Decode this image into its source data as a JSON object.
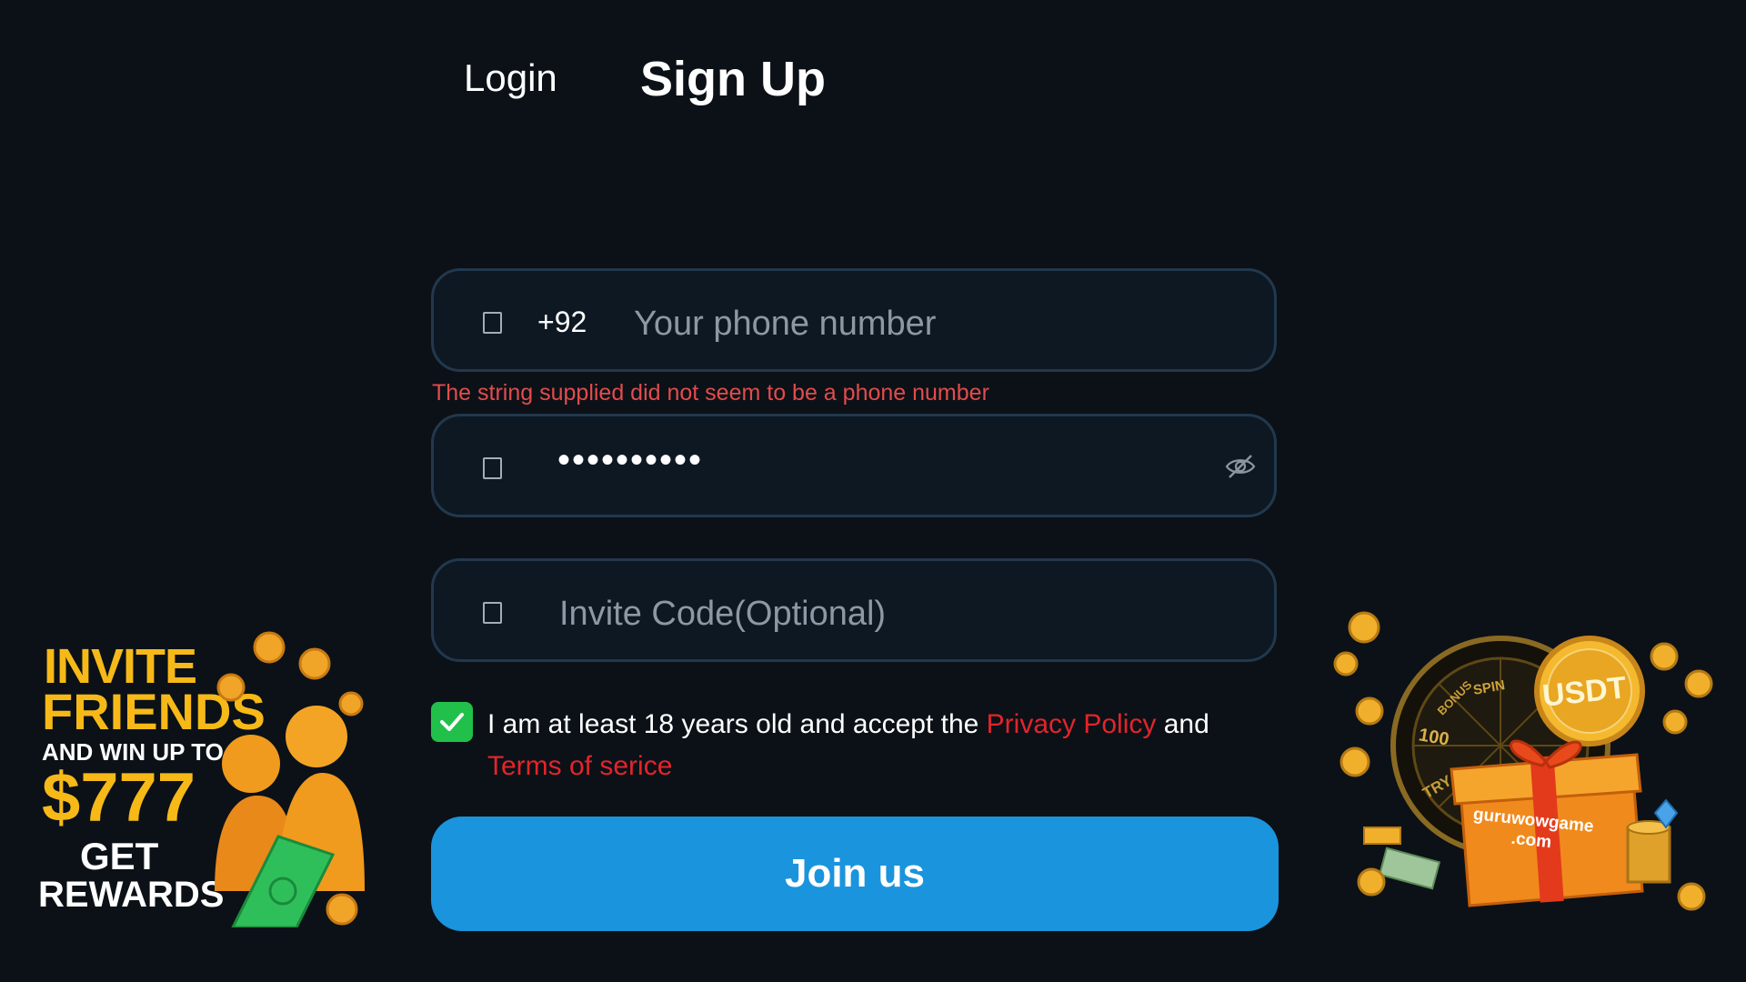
{
  "tabs": {
    "login_label": "Login",
    "signup_label": "Sign Up"
  },
  "phone": {
    "country_code": "+92",
    "placeholder": "Your phone number",
    "value": "",
    "error": "The string supplied did not seem to be a phone number"
  },
  "password": {
    "masked_value": "••••••••••"
  },
  "invite": {
    "placeholder": "Invite Code(Optional)",
    "value": ""
  },
  "agreement": {
    "checked": true,
    "text_prefix": "I am at least 18 years old and accept the ",
    "privacy_link": "Privacy Policy",
    "text_and": " and",
    "terms_link": "Terms of serice"
  },
  "submit": {
    "label": "Join us"
  },
  "promo_left": {
    "line1": "INVITE",
    "line2": "FRIENDS",
    "line3": "AND WIN UP TO",
    "amount": "$777",
    "line5": "GET",
    "line6": "REWARDS"
  },
  "promo_right": {
    "coin_label": "USDT",
    "wheel_spin": "SPIN",
    "wheel_bonus": "BONUS",
    "wheel_prize": "100",
    "wheel_try": "TRY",
    "gift_line1": "guruwowgame",
    "gift_line2": ".com"
  },
  "colors": {
    "background": "#0b1117",
    "accent_button": "#1a94dc",
    "error": "#e24c4c",
    "link": "#e3242b",
    "checkbox": "#21c04a",
    "promo_gold": "#f6b918"
  }
}
